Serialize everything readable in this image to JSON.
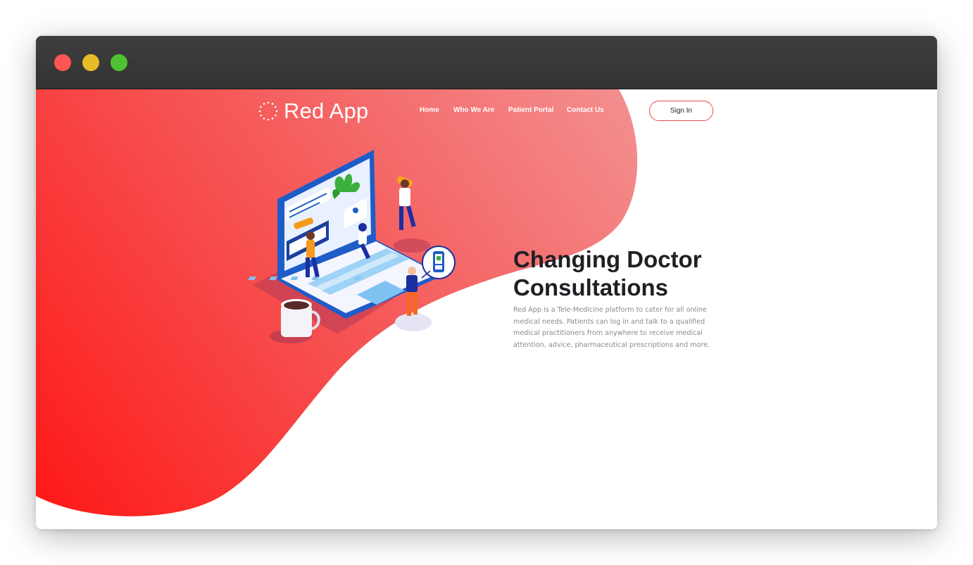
{
  "window": {
    "controls": [
      "close",
      "minimize",
      "maximize"
    ]
  },
  "brand": {
    "name": "Red App",
    "logo_icon": "dotted-circle-icon"
  },
  "nav": {
    "items": [
      {
        "label": "Home"
      },
      {
        "label": "Who We Are"
      },
      {
        "label": "Patient Portal"
      },
      {
        "label": "Contact Us"
      }
    ],
    "signin_label": "Sign In"
  },
  "hero": {
    "title": "Changing Doctor Consultations",
    "description": "Red App is a Tele-Medicine platform to cater for all online medical needs. Patients can log in and talk to a qualified medical practitioners from anywhere to receive medical attention, advice, pharmaceutical prescriptions and more.",
    "illustration": "telemedicine-laptop-illustration"
  },
  "colors": {
    "brand_red": "#fe1716",
    "brand_red_light": "#f38a8a",
    "title_dark": "#1f1f24",
    "body_gray": "#8a8a8a",
    "laptop_blue": "#1e5cc8"
  }
}
